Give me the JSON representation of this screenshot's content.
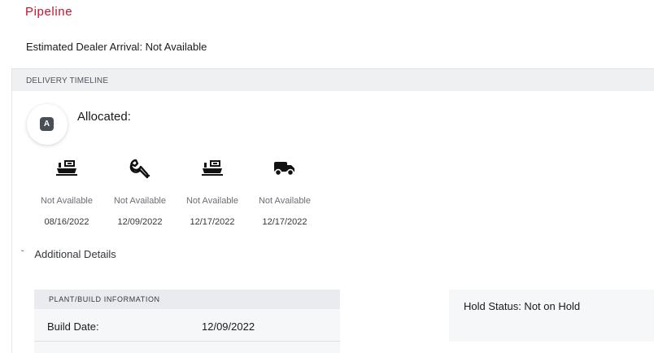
{
  "page": {
    "title": "Pipeline"
  },
  "arrival": {
    "text": "Estimated Dealer Arrival: Not Available"
  },
  "timeline": {
    "header": "DELIVERY TIMELINE",
    "badge_letter": "A",
    "status_label": "Allocated:",
    "steps": [
      {
        "icon": "ship-icon",
        "status": "Not Available",
        "date": "08/16/2022"
      },
      {
        "icon": "wrench-icon",
        "status": "Not Available",
        "date": "12/09/2022"
      },
      {
        "icon": "ship-icon",
        "status": "Not Available",
        "date": "12/17/2022"
      },
      {
        "icon": "truck-icon",
        "status": "Not Available",
        "date": "12/17/2022"
      }
    ]
  },
  "additional_details": {
    "label": "Additional Details"
  },
  "plant_build": {
    "header": "PLANT/BUILD INFORMATION",
    "build_date_label": "Build Date:",
    "build_date_value": "12/09/2022"
  },
  "hold": {
    "text": "Hold Status: Not on Hold"
  }
}
